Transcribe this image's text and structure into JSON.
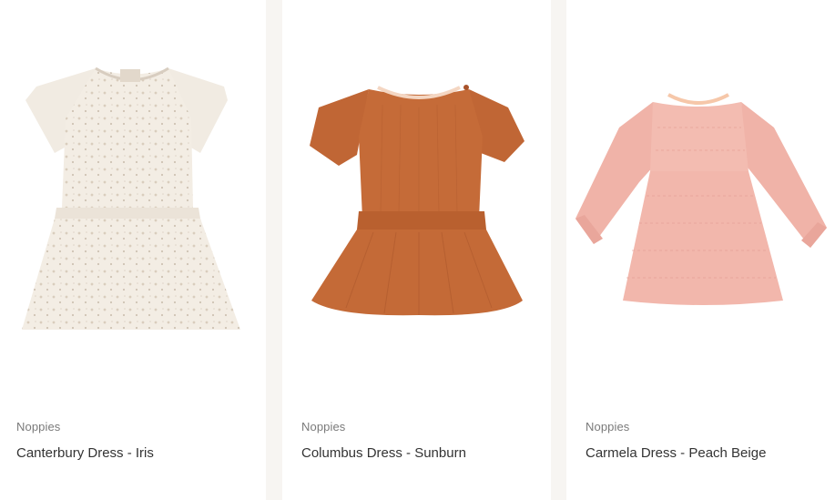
{
  "products": [
    {
      "brand": "Noppies",
      "name": "Canterbury Dress - Iris",
      "image": "ivory-floral-short-sleeve-dress",
      "color": "#efe9e0"
    },
    {
      "brand": "Noppies",
      "name": "Columbus Dress - Sunburn",
      "image": "rust-orange-ribbed-dress",
      "color": "#c46a37"
    },
    {
      "brand": "Noppies",
      "name": "Carmela Dress - Peach Beige",
      "image": "pink-long-sleeve-dress",
      "color": "#f1b9ad"
    }
  ]
}
